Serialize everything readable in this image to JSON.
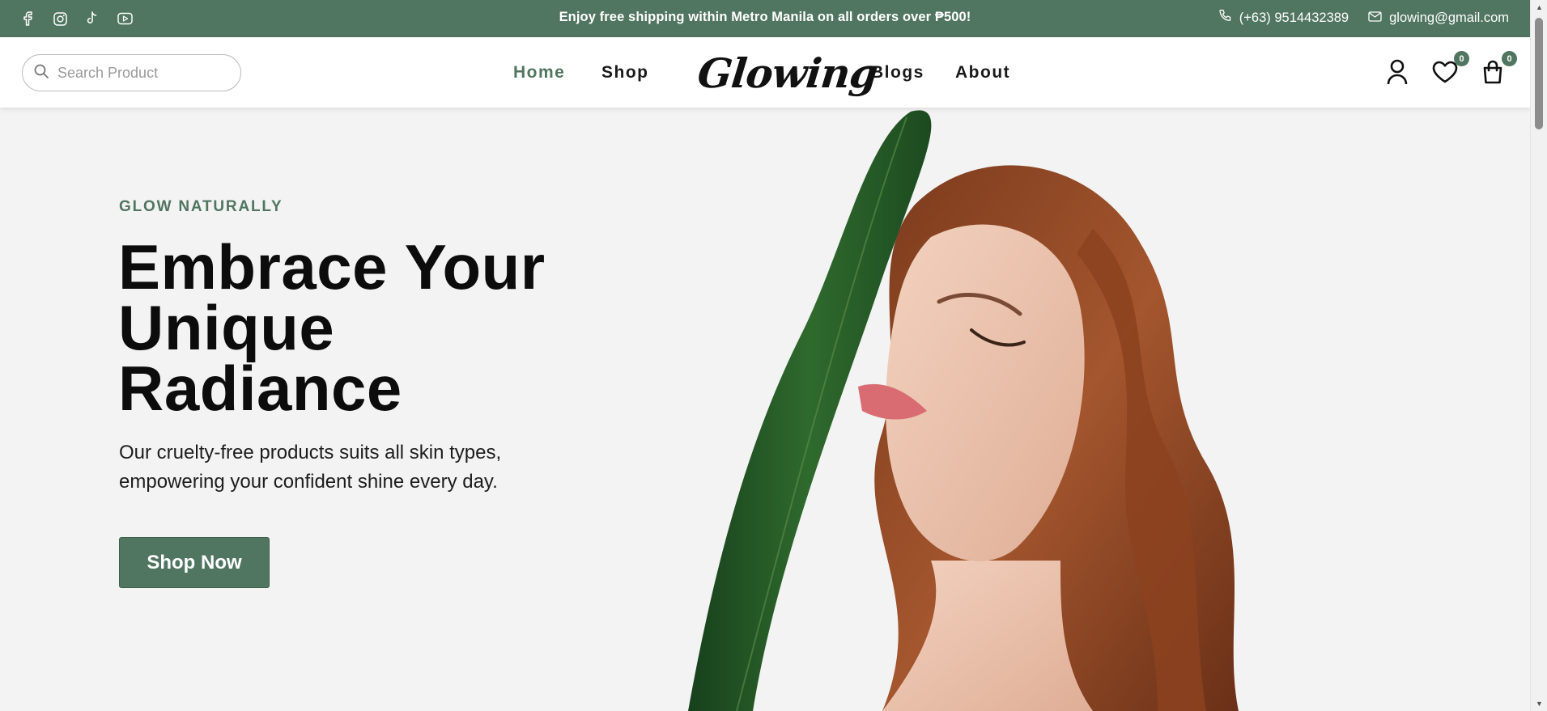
{
  "topbar": {
    "social": [
      {
        "name": "facebook-icon"
      },
      {
        "name": "instagram-icon"
      },
      {
        "name": "tiktok-icon"
      },
      {
        "name": "youtube-icon"
      }
    ],
    "announcement": "Enjoy free shipping within Metro Manila on all orders over ₱500!",
    "phone": "(+63) 9514432389",
    "email": "glowing@gmail.com"
  },
  "header": {
    "search_placeholder": "Search Product",
    "nav": {
      "home": "Home",
      "shop": "Shop",
      "blogs": "Blogs",
      "about": "About"
    },
    "logo": "Glowing",
    "wishlist_count": "0",
    "cart_count": "0"
  },
  "hero": {
    "eyebrow": "GLOW NATURALLY",
    "headline_1": "Embrace Your",
    "headline_2": "Unique",
    "headline_3": "Radiance",
    "subtext": "Our cruelty-free products suits all skin types, empowering your confident shine every day.",
    "cta": "Shop Now"
  },
  "colors": {
    "brand_green": "#507560",
    "hero_bg": "#f3f3f3"
  }
}
